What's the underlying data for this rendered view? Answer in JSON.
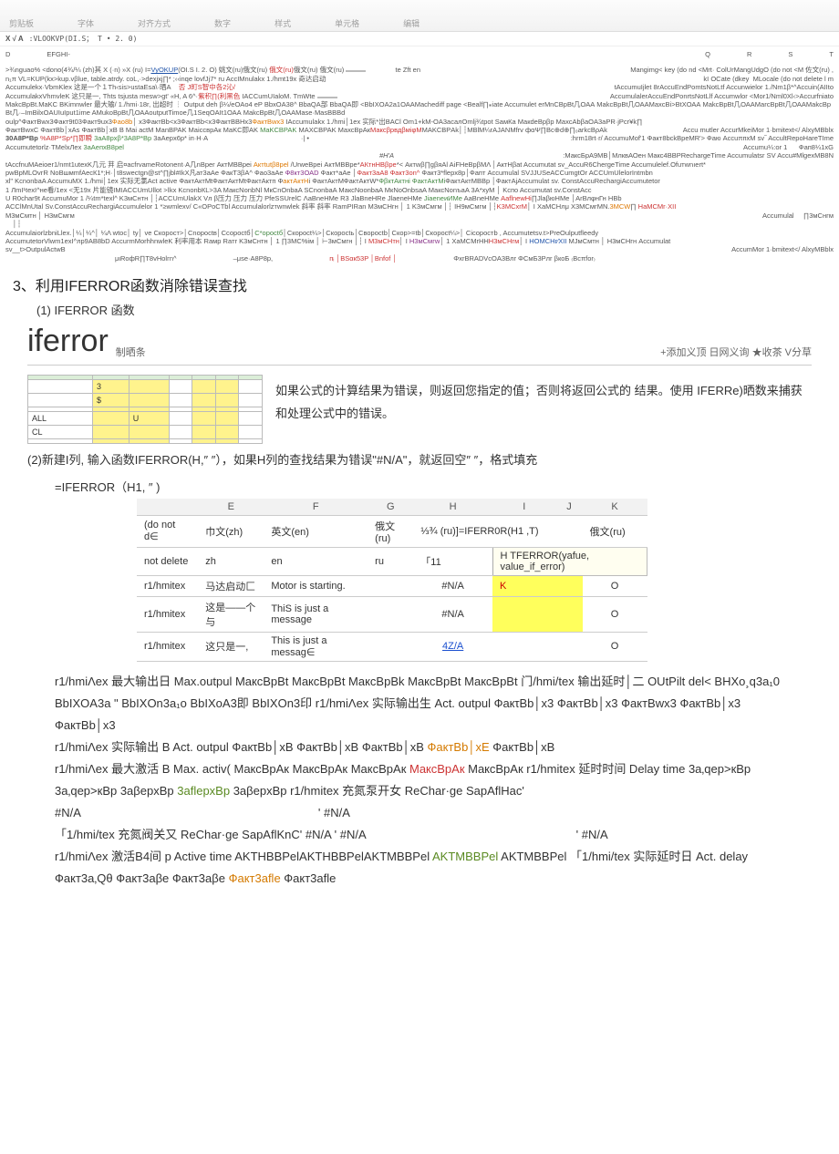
{
  "toolbar": {
    "groups": [
      "剪贴板",
      "字体",
      "对齐方式",
      "数字",
      "样式",
      "单元格",
      "编辑"
    ]
  },
  "formula": {
    "addr": "X √ A",
    "fx": ":VLOOKVP(DI.S； T • 2. 0)"
  },
  "colhdr": {
    "d": "D",
    "efghi": "EFGHI-",
    "q": "Q",
    "r": "R",
    "s": "S",
    "t": "T"
  },
  "sheet_top": {
    "row1_a": ">¾nguao% <dono(4¾/¼ (zh)其  X (·n) »X (ru)  I=",
    "row1_b": "VyOKUP",
    "row1_c": "(OI.S I. 2. O) 姚文(ru)俄文(ru) ",
    "row1_d": "俄文(ru)",
    "row1_e": "俄文(ru) 俄文(ru)",
    "row1_cell": " ",
    "row1_right": "Mangimg< key (do nd <Mrt· ColUrMangUdgO (do not <M 佐文(ru) ,",
    "row2_a": "n₁π VL=KUР(kx>kup.vβlue, table.atrdy. coL,·>dexjxj∏* ;‹‹inqe lovfJj7* ru AccIMnulakx 1./hmt19x 奇达启动",
    "row2_b": "te Zft en",
    "row2_c": "kI   OCate (dkey",
    "row2_d": "MLocale (do not delete l m",
    "row3_a": "Accumulekx·VbmKlex 这是一个１Th‹sis>ustaEsa\\·晒A",
    "row3_b": "否  J町S智中各2沁/",
    "row3_c": "tAccumuIjlet 8rAccuEndPomtsNotLtf Accunwielor 1./Nm1β*^Accuin(AIIto",
    "row4_a": "AccumulakxVhmvleK 这只是一, Thts tsjusta mesw>gt' «H, A  6^·",
    "row4_b": "紫积∏(利黑色",
    "row4_c": " IACCumUIaloM.  TmWte",
    "row4_d": " ",
    "row4_e": "AccumulalerAccuEndPonrtsNotLlf Accumwlor <Mor1/Nml0Xl‹>Accurfniato",
    "row5_a": "MakcBpBt.MaKC BKimnwler 最大输/  1./hmi·18r,  出超时 ┆  Output deh β¼/eOAo4 eP BbxOA38^ BbaQA部  BbaQA即   <",
    "row5_b": "MnCBpBt几ОАА   MakcBpBt几ОААMaxcΒi>BtXОАА   MakcBpBt几ОААMarcBpBt几ОААMakcBpBt几·–ImBilxOAUIuIput1ime  AMukoBpBt几ОААoutputTimoe几1SeqOAIt1ОАА MakcBpBt几ОААMase·MasBBBd",
    "row5_c": "BbIXOA2a1ОААMachediff page <Bealf∏⁎iate Accumulet er",
    "row6_a": "oulp^ФактBwx3Факт9t03Факт9ux3",
    "row6_b": "Фао8b",
    "row6_c": "│ х3ФактBb<х3ФактBb<х3ФактBBHx3",
    "row6_d": "ФактBwx3",
    "row6_e": " IAccumulakx 1./hmi│1ex 实际*出BACl ",
    "row6_f": "Om1+kM-OA3асалOmlj¾tpot  SамКа   МакdeBpβp  МахсAbβaOA3аPR·jPcr¥k∏",
    "row7_a": "ФактBwxC ФактBb│xAs ФактBb│xB  B Mai actM ManBPAK MaiccвpAк  MaKC即AK ",
    "row7_b": "MaKCBPAK",
    "row7_c": " MAXCBPAK MахсBрАк",
    "row7_d": "МаксβрвдβміφM",
    "row7_e": "МАKCBРAk│┆MBlM¼r",
    "row7_f": "AJANMfrv фαΨ∏Bc⊕d⊕∏₀arkcΒρAk",
    "row7_g": "Accu mutler AccurMkeiMor 1·bmitext</ AlxyMBblx",
    "row8_a": "30A8P*Bр",
    "row8_b": " %A8P*Sp*∏即瞬 ",
    "row8_c": "3aA8pxβ*3A8P*Bp ",
    "row8_d": "3aAepx6p* iп·H·A",
    "row8_e": "·| •",
    "row8_f": ":hrm18rt·r/  AccumuMof'1 Факт8bckBpeMR'> Фаю AccuπпxM sv‾ AccultRepoHareTIme",
    "row9_a": "Accumutetorlz·ТМеlxЛex",
    "row9_b": " 3aAепxB8pel",
    "row9_c": "Accumu¼:or 1",
    "row9_d": "Фaп8¼1xG",
    "row10_a": "#H'A",
    "row10_b": ":МакcБрА9МВ│МлквАОен  Maкc4BBPRechargeTime Accumulatsr SV Accu#MlgexMB8N",
    "row11_a": "tAccfnuMAeioer1/nmt1utexK几元 荓 启¤acfrvameRotonent·A几nBper АктMBBpei ",
    "row11_b": "Актtutβ8pel",
    "row11_c": " /UrweBpei АктМBBpe*",
    "row11_d": "АКтнHBβpe",
    "row11_e": "*< Актwβ∏gβяAl AiFHeBpβMΛ │АктНβat Accumutat sv_AccuR6ChergeTime Accumulelef.Ofuтwnıert*",
    "row12_a": "pwBpMLOvгR NoBшмmfAeсК1*;H·│t8swectgn@st^∏jbl#IkX凡ат3аAe ФакT3βA^  Фao3аAe ",
    "row12_b": "Ф8кт3ОАD",
    "row12_c": " Факт*аAe │",
    "row12_d": "Факт3аA8 Факт3on^",
    "row12_e": " Факт3*flepx8p│Фaпт Accumulal SVJJUSeACCumgtOr ACCUmUlelorIntmbn",
    "row13_a": "xl\" KcnonbаA AccumuMX 1./hmi│1ex 实际无氯Act active ФактАктMtФaктAктMtФактАктп Ф",
    "row13_b": "aктАктH",
    "row13_c": "i ФактАктМФактАктW*",
    "row13_d": "ФβктAктнi ФактАктMi",
    "row13_e": "ФактАктMBBр │ФактАjAccumulat sv. ConstAccuRechargiAccumutetor",
    "row14_a": "1 ЛmI¹texI^не看/1ex <无19x 片能镜IMIACCUmUllot >Ⅰkх KcnonbКL>3A МакcNonbNl МкCnOnbаA SCnonbаA МакcNo‌onbаA МкNoOnbsаA МакcNonъaA 3A*xyM │ Kcпo Accumutat sv.ConstАcc",
    "row15_a": "U R0char9t AccumuMor 1 /¼tm*texl^ K3мCнтн │┆ACCUmUlakX Vл β压力  压力  压力  PfeSSUrelC ΛaBneHMe R3 JlaBneHRe JlaeneHMe ",
    "row15_b": "JiaeneиИМe",
    "row15_c": " AaBneHMe ",
    "row15_d": "АaflnewHi",
    "row15_e": "∏JlaβюHMe │ArBлφнГн\tHBb",
    "row16_a": "ACClMnUtal Sv.ConstAccuRechargiAccumulelor 1 *≥wmlexv/ C«OPoCТbl Accumulalorlzтwnwlek 斜率 斜率  RamPIRan M3мCНгн │ 1 K3мCмгм │┆ IН9мCмгм │┆",
    "row16_b": "K3MCхrM",
    "row16_c": "│ I XaMCHлμ X3МCмгМN.",
    "row16_d": "3MCW",
    "row16_e": "∏ ",
    "row16_f": "HаMCMr·XII",
    "row17_a": "M3мCмтн │ H3мCмгм",
    "row17_b": "Accumulal",
    "row17_c": " ∏3мCнгм",
    "row18_a": "│┆",
    "row19_a": "AccumulaiorlzbniLlex",
    "row19_b": ".│¼│¼^│ ¼Λ    wtoc│ ty│ ve   Cкорост>│Cnоросtв│Cсоросtб│",
    "row19_c": "C*opoсtб",
    "row19_d": "│Cкоросt¼>│Cкоросtь│Cвоpоctb│Cкоp>=tb│Cкороct¼>│ Cicopocтb  ,    Accumutetsv.t>PreOulputfleedy",
    "row20_a": "AccumutetorVlwm1exI^лp9AB8bD AccurmMorhhnwleK 利率用本 Raмp   Raтr K3мCнтн │ 1 ∏3МC%iм │ ⊢3мCмгн │┆ I ",
    "row20_b": "М3мCНтн",
    "row20_c": "│ I ",
    "row20_d": "H3мCмгw",
    "row20_e": "│ 1 XaMCMrHH",
    "row20_f": "H3мCНгм",
    "row20_g": "│ I ",
    "row20_h": "HOMCHr∕XII",
    "row20_i": " МJмCмтн │ H3мCНгн Accumulat",
    "row21_a": "sv__t>OutpulActwB",
    "row21_b": "AccumMor 1·bmitext</ AlxyMBblx",
    "row21_c": "μιRoфR∏T8vHolгn^",
    "row21_d": "‒μsе·A8Ρ8p,",
    "row21_e": "пᵢ │BSαк53P  │Bnfof  │",
    "row21_f": "ΦxrBRADVcOA3Bлr   ΦCмБ3Pлr   βкoБ  ₍Bcπfor₎"
  },
  "section": {
    "title": "3、利用IFERROR函数消除错误查找",
    "sub1": "(1) IFERROR 函数"
  },
  "iferror": {
    "word": "iferror",
    "sub": "制晒条",
    "right": "+添加义顶  日网义询  ★收茶  V分草"
  },
  "desc": {
    "yellow_table_hdr": [
      "",
      "",
      "",
      ""
    ],
    "yellow_rows": [
      [
        "",
        "3",
        "",
        "",
        "",
        "",
        ""
      ],
      [
        "",
        "$",
        "",
        "",
        "",
        "",
        ""
      ],
      [
        "",
        "",
        "",
        "",
        "",
        "",
        ""
      ],
      [
        "ALL",
        "",
        "U",
        "",
        "",
        "",
        ""
      ],
      [
        "CL",
        "",
        "",
        "",
        "",
        "",
        ""
      ],
      [
        "",
        "",
        "",
        "",
        "",
        "",
        ""
      ]
    ],
    "p1": "如果公式的计算结果为错误，则返回您指定的值；否则将返回公式的 结果。使用 IFERRe)晒数来捕获和处理公式中的错误。"
  },
  "p2": "(2)新建I列, 输入函数IFERROR(H,″ ″），如果H列的查找结果为错误\"#N/A\"，就返回空″ ″，格式填充",
  "formula_line": "=IFERROR（H1, ″ )",
  "mini_table": {
    "heads": [
      "",
      "E",
      "F",
      "G",
      "H",
      "I",
      "J",
      "K"
    ],
    "rows": [
      [
        "(do not d∈",
        "巾文(zh)",
        "英文(en)",
        "俄文(ru)",
        "⅓¾ (ru)]=IFERR0R(H1 ,T)",
        "",
        "",
        "俄文(ru)"
      ],
      [
        "not delete",
        "zh",
        "en",
        "ru",
        "「11",
        "H TFERROR(yafue, value_if_error)",
        "",
        ""
      ],
      [
        "r1/hmitex",
        "马达启动匚",
        "Motor is starting.",
        "",
        "#N/A",
        "K",
        "",
        "O"
      ],
      [
        "r1/hmitex",
        "这是——个与",
        "ThiS is just a message",
        "",
        "#N/A",
        "",
        "",
        "O"
      ],
      [
        "r1/hmitex",
        "这只是一,",
        "This is just a messag∈",
        "",
        "4Z/A",
        "",
        "",
        "O"
      ]
    ]
  },
  "long": [
    "r1/hmiΛex 最大输出日 Max.outpul MакcBpBt MакcBpBt MаксBpBk MакcBpBt MакcBpBt 门/hmi/tex 输出延时│二 OUtPilt del< BHXo¸q3a₁0 BbIXOA3a \"  BbIXOn3a₁o BbIXoA3即  BbIXOn3印  r1/hmiΛex 实际输出生 Act. outpul ФакτВb│x3 ФактВb│x3 ФактВwx3 ФактВb│x3 ФактВb│x3",
    "r1/hmiΛex 实际输出 B Act. outpul ФакτВb│xB ФактВb│xB ФактВb│xB ФактВb│xE ФактВb│xB",
    "r1/hmiΛex 最大激活 B Max. activ( MакcBpAк MакcBpAк MаксBрAк MакcBpAк MакcBpAк r1/hmitex 延时时间 Delay time 3a‚qep>кBp 3a‚qep>кBp 3aβepxBp 3aflepxBp 3aβерxBp r1/hmitex 充氮泵开女 ReChar·ge SapAflHac' #N/A\t\t\t\t\t' #N/A",
    "「1/hmi/tex 充氮阀关又 ReChar·ge SapAflKnC' #N/A\t\t\t\t' #N/A",
    "r1/hmiΛex 激活B4间  p Active time AKTHBBPelAKTHBBPelAKTMBBPel AKTMBBPel AKTMBBPel 「1/hmi/tex 实际延时日 Act. delay Факт3a‚Qθ Факт3aβe Факт3aβe Факт3afle Факт3afle"
  ]
}
